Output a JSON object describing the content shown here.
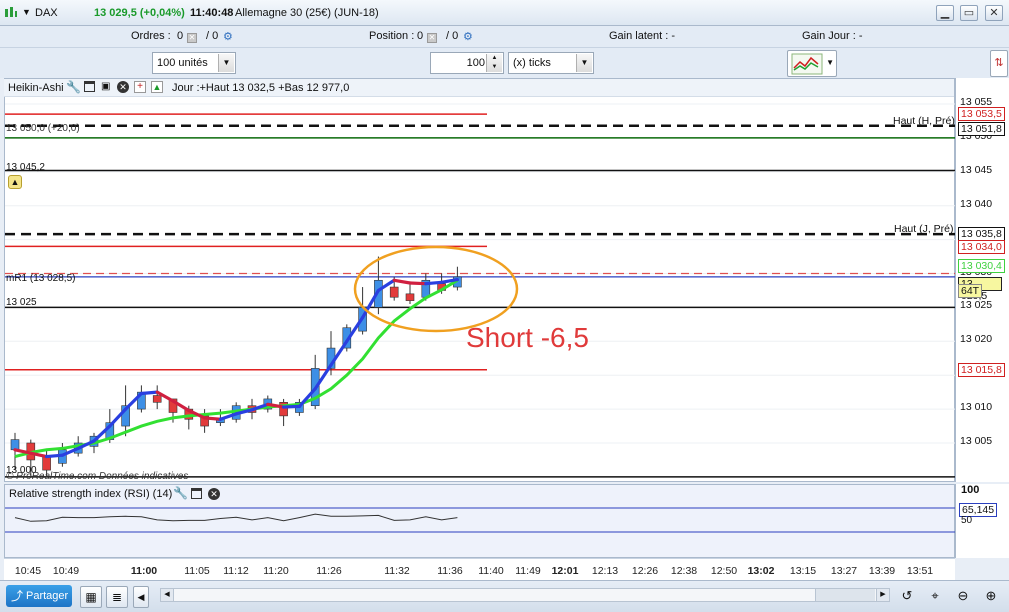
{
  "titlebar": {
    "symbol": "DAX",
    "price_change": "13 029,5 (+0,04%)",
    "time": "11:40:48",
    "description": "Allemagne 30 (25€) (JUN-18)"
  },
  "orderbar": {
    "orders_label": "Ordres :",
    "orders_value": "0",
    "orders_sep": "/ 0",
    "position_label": "Position :",
    "position_value": "0",
    "position_sep": "/ 0",
    "gain_latent": "Gain latent :  -",
    "gain_jour": "Gain Jour :  -"
  },
  "controls": {
    "quantity": "100 unités",
    "ticks_value": "100",
    "ticks_unit": "(x) ticks"
  },
  "chart_header": {
    "type": "Heikin-Ashi",
    "info": "Jour :+Haut 13 032,5 +Bas 12 977,0"
  },
  "chart_labels": {
    "l1": "13 050,0 (+20,0)",
    "l2": "13 045,2",
    "mr1": "mR1 (13 028,5)",
    "l3": "13 025",
    "l4": "13 000",
    "haut_h": "Haut (H, Pré)",
    "haut_j": "Haut (J, Pré)",
    "watermark": "© ProRealTime.com  Données indicatives",
    "annotation": "Short -6,5"
  },
  "y_axis": {
    "ticks": [
      "13 055",
      "13 050",
      "13 045",
      "13 040",
      "13 035",
      "13 030",
      "13 025",
      "13 020",
      "13 015",
      "13 010",
      "13 005"
    ],
    "tags": {
      "t1": "13 053,5",
      "t2": "13 051,8",
      "t3": "13 035,8",
      "t4": "13 034,0",
      "t5": "13 030,4",
      "t6": "13 029,5",
      "t7": "64T",
      "t8": "13 015,8"
    }
  },
  "rsi": {
    "title": "Relative strength index (RSI) (14)",
    "axis_top": "100",
    "value": "65,145",
    "level": "50"
  },
  "time_axis": [
    "10:45",
    "10:49",
    "11:00",
    "11:05",
    "11:12",
    "11:20",
    "11:26",
    "11:32",
    "11:36",
    "11:40",
    "11:49",
    "12:01",
    "12:13",
    "12:26",
    "12:38",
    "12:50",
    "13:02",
    "13:15",
    "13:27",
    "13:39",
    "13:51"
  ],
  "bottombar": {
    "share_label": "Partager"
  },
  "chart_data": {
    "type": "candlestick",
    "title": "",
    "x": [
      "10:45",
      "10:49",
      "11:00",
      "11:05",
      "11:12",
      "11:20",
      "11:26",
      "11:32",
      "11:36",
      "11:40"
    ],
    "ylim": [
      13000,
      13057
    ],
    "candles": [
      {
        "o": 13004.0,
        "c": 13005.5,
        "h": 13006.5,
        "l": 13001.0
      },
      {
        "o": 13005.0,
        "c": 13002.5,
        "h": 13005.5,
        "l": 13000.0
      },
      {
        "o": 13003.0,
        "c": 13001.0,
        "h": 13004.0,
        "l": 13000.0
      },
      {
        "o": 13002.0,
        "c": 13004.0,
        "h": 13005.0,
        "l": 13001.5
      },
      {
        "o": 13003.5,
        "c": 13005.0,
        "h": 13006.0,
        "l": 13003.0
      },
      {
        "o": 13004.5,
        "c": 13006.0,
        "h": 13006.5,
        "l": 13003.5
      },
      {
        "o": 13005.5,
        "c": 13008.0,
        "h": 13010.0,
        "l": 13005.0
      },
      {
        "o": 13007.5,
        "c": 13010.5,
        "h": 13013.5,
        "l": 13006.0
      },
      {
        "o": 13010.0,
        "c": 13012.5,
        "h": 13013.5,
        "l": 13009.5
      },
      {
        "o": 13012.0,
        "c": 13011.0,
        "h": 13013.5,
        "l": 13010.0
      },
      {
        "o": 13011.5,
        "c": 13009.5,
        "h": 13011.5,
        "l": 13008.0
      },
      {
        "o": 13010.0,
        "c": 13008.5,
        "h": 13010.5,
        "l": 13007.0
      },
      {
        "o": 13009.0,
        "c": 13007.5,
        "h": 13010.0,
        "l": 13006.5
      },
      {
        "o": 13008.0,
        "c": 13008.5,
        "h": 13010.0,
        "l": 13007.5
      },
      {
        "o": 13008.5,
        "c": 13010.5,
        "h": 13011.0,
        "l": 13008.0
      },
      {
        "o": 13010.5,
        "c": 13009.5,
        "h": 13011.5,
        "l": 13008.5
      },
      {
        "o": 13010.0,
        "c": 13011.5,
        "h": 13012.0,
        "l": 13009.5
      },
      {
        "o": 13011.0,
        "c": 13009.0,
        "h": 13011.5,
        "l": 13007.5
      },
      {
        "o": 13009.5,
        "c": 13011.0,
        "h": 13011.5,
        "l": 13009.0
      },
      {
        "o": 13010.5,
        "c": 13016.0,
        "h": 13018.0,
        "l": 13010.0
      },
      {
        "o": 13016.0,
        "c": 13019.0,
        "h": 13021.5,
        "l": 13015.0
      },
      {
        "o": 13019.0,
        "c": 13022.0,
        "h": 13022.5,
        "l": 13018.5
      },
      {
        "o": 13021.5,
        "c": 13025.0,
        "h": 13028.0,
        "l": 13021.0
      },
      {
        "o": 13025.0,
        "c": 13029.0,
        "h": 13032.5,
        "l": 13024.0
      },
      {
        "o": 13028.0,
        "c": 13026.5,
        "h": 13029.5,
        "l": 13026.0
      },
      {
        "o": 13027.0,
        "c": 13026.0,
        "h": 13028.5,
        "l": 13025.5
      },
      {
        "o": 13026.5,
        "c": 13029.0,
        "h": 13030.0,
        "l": 13026.0
      },
      {
        "o": 13028.5,
        "c": 13027.5,
        "h": 13030.0,
        "l": 13027.0
      },
      {
        "o": 13028.0,
        "c": 13029.5,
        "h": 13031.0,
        "l": 13027.5
      }
    ],
    "ma_fast": [
      13004.0,
      13003.5,
      13003.0,
      13003.2,
      13004.2,
      13005.3,
      13007.5,
      13010.0,
      13012.3,
      13012.5,
      13011.2,
      13009.8,
      13008.7,
      13008.5,
      13009.3,
      13009.9,
      13010.7,
      13010.3,
      13010.4,
      13013.0,
      13016.5,
      13020.0,
      13023.5,
      13027.5,
      13029.0,
      13028.6,
      13028.5,
      13028.7,
      13029.1
    ],
    "ma_slow": [
      13003.0,
      13003.6,
      13004.0,
      13004.2,
      13004.6,
      13005.0,
      13005.7,
      13006.6,
      13007.5,
      13008.2,
      13008.7,
      13009.0,
      13009.2,
      13009.4,
      13009.7,
      13010.0,
      13010.3,
      13010.5,
      13010.7,
      13011.6,
      13013.0,
      13015.0,
      13017.4,
      13020.5,
      13023.0,
      13024.8,
      13026.4,
      13027.6,
      13029.0
    ]
  }
}
